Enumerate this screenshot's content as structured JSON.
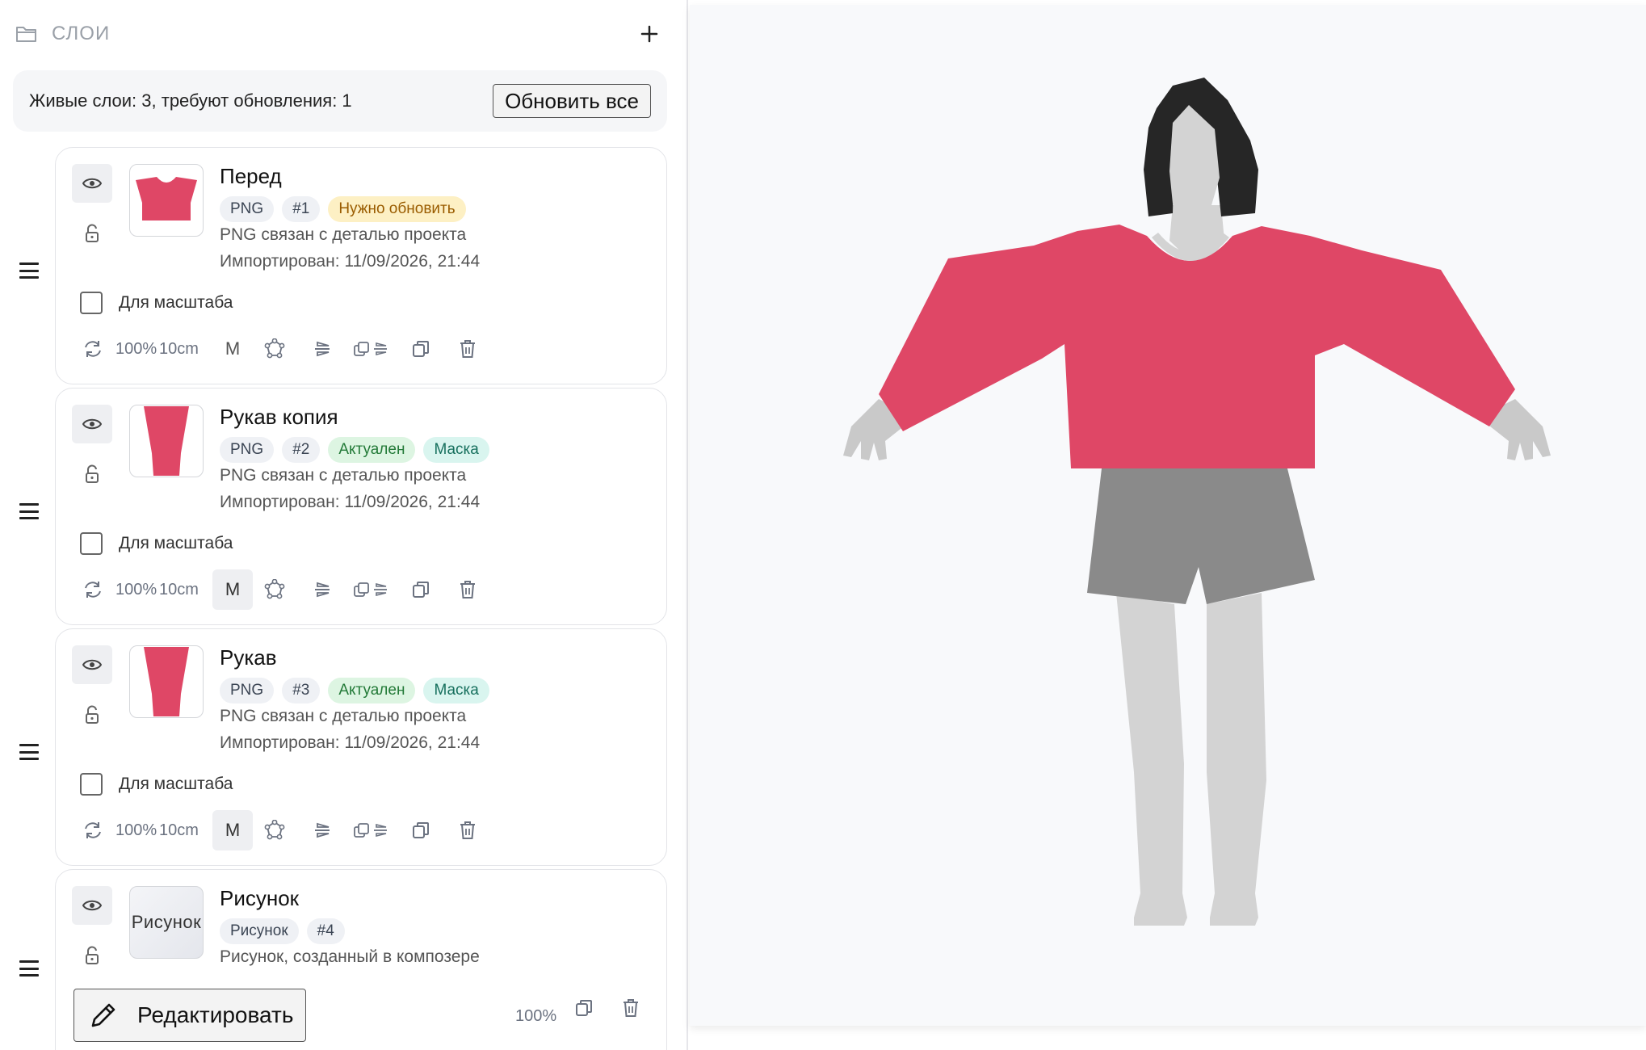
{
  "panel": {
    "title": "СЛОИ",
    "add_icon": "plus-icon"
  },
  "status": {
    "text": "Живые слои: 3, требуют обновления: 1",
    "update_all_label": "Обновить все"
  },
  "layers": [
    {
      "name": "Перед",
      "tags": [
        "PNG",
        "#1",
        "Нужно обновить"
      ],
      "description": "PNG связан с деталью проекта",
      "imported": "Импортирован: 11/09/2026, 21:44",
      "scale_label": "Для масштаба",
      "scale_checked": false,
      "zoom": "100%",
      "size": "10cm",
      "m_label": "M",
      "m_active": false
    },
    {
      "name": "Рукав копия",
      "tags": [
        "PNG",
        "#2",
        "Актуален",
        "Маска"
      ],
      "description": "PNG связан с деталью проекта",
      "imported": "Импортирован: 11/09/2026, 21:44",
      "scale_label": "Для масштаба",
      "scale_checked": false,
      "zoom": "100%",
      "size": "10cm",
      "m_label": "M",
      "m_active": true
    },
    {
      "name": "Рукав",
      "tags": [
        "PNG",
        "#3",
        "Актуален",
        "Маска"
      ],
      "description": "PNG связан с деталью проекта",
      "imported": "Импортирован: 11/09/2026, 21:44",
      "scale_label": "Для масштаба",
      "scale_checked": false,
      "zoom": "100%",
      "size": "10cm",
      "m_label": "M",
      "m_active": true
    },
    {
      "name": "Рисунок",
      "thumb_text": "Рисунок",
      "tags": [
        "Рисунок",
        "#4"
      ],
      "description": "Рисунок, созданный в композере",
      "edit_label": "Редактировать",
      "zoom": "100%"
    }
  ],
  "colors": {
    "garment": "#df4766",
    "shorts": "#8a8a8a",
    "skin": "#d3d3d3",
    "hair": "#262626",
    "warn_bg": "#fdf0c4",
    "ok_bg": "#ddf5e2",
    "mask_bg": "#d9f5ef"
  },
  "icons": [
    "folder-icon",
    "plus-icon",
    "eye-icon",
    "lock-open-icon",
    "drag-handle-icon",
    "rotate-icon",
    "transform-icon",
    "flip-icon",
    "duplicate-flip-icon",
    "copy-icon",
    "trash-icon",
    "pencil-icon"
  ]
}
